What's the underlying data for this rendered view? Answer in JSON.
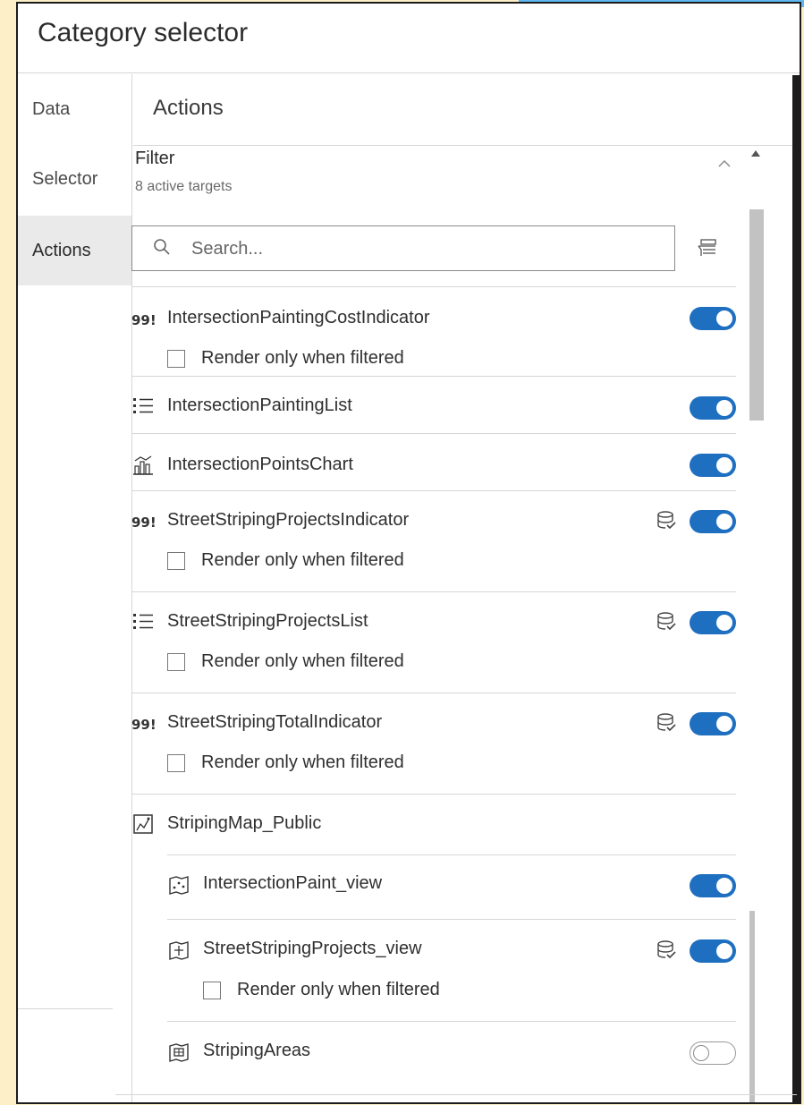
{
  "panel": {
    "title": "Category selector"
  },
  "sidenav": {
    "items": [
      {
        "label": "Data"
      },
      {
        "label": "Selector"
      },
      {
        "label": "Actions"
      }
    ],
    "active": "Actions"
  },
  "content": {
    "title": "Actions"
  },
  "filter": {
    "title": "Filter",
    "subtitle": "8 active targets"
  },
  "search": {
    "placeholder": "Search..."
  },
  "targets": [
    {
      "label": "IntersectionPaintingCostIndicator",
      "icon": "indicator-icon",
      "enabled": true,
      "data_icon": false,
      "render_label": "Render only when filtered"
    },
    {
      "label": "IntersectionPaintingList",
      "icon": "list-icon",
      "enabled": true,
      "data_icon": false
    },
    {
      "label": "IntersectionPointsChart",
      "icon": "chart-icon",
      "enabled": true,
      "data_icon": false
    },
    {
      "label": "StreetStripingProjectsIndicator",
      "icon": "indicator-icon",
      "enabled": true,
      "data_icon": true,
      "render_label": "Render only when filtered"
    },
    {
      "label": "StreetStripingProjectsList",
      "icon": "list-icon",
      "enabled": true,
      "data_icon": true,
      "render_label": "Render only when filtered"
    },
    {
      "label": "StreetStripingTotalIndicator",
      "icon": "indicator-icon",
      "enabled": true,
      "data_icon": true,
      "render_label": "Render only when filtered"
    },
    {
      "label": "StripingMap_Public",
      "icon": "map-icon"
    },
    {
      "label": "IntersectionPaint_view",
      "icon": "point-layer-icon",
      "enabled": true,
      "data_icon": false
    },
    {
      "label": "StreetStripingProjects_view",
      "icon": "polygon-layer-icon",
      "enabled": true,
      "data_icon": true,
      "render_label": "Render only when filtered"
    },
    {
      "label": "StripingAreas",
      "icon": "area-layer-icon",
      "enabled": false,
      "data_icon": false
    }
  ],
  "colors": {
    "toggle_on": "#1f6fc0",
    "background": "#fdf0c8",
    "top_strip": "#5fb6f0"
  }
}
